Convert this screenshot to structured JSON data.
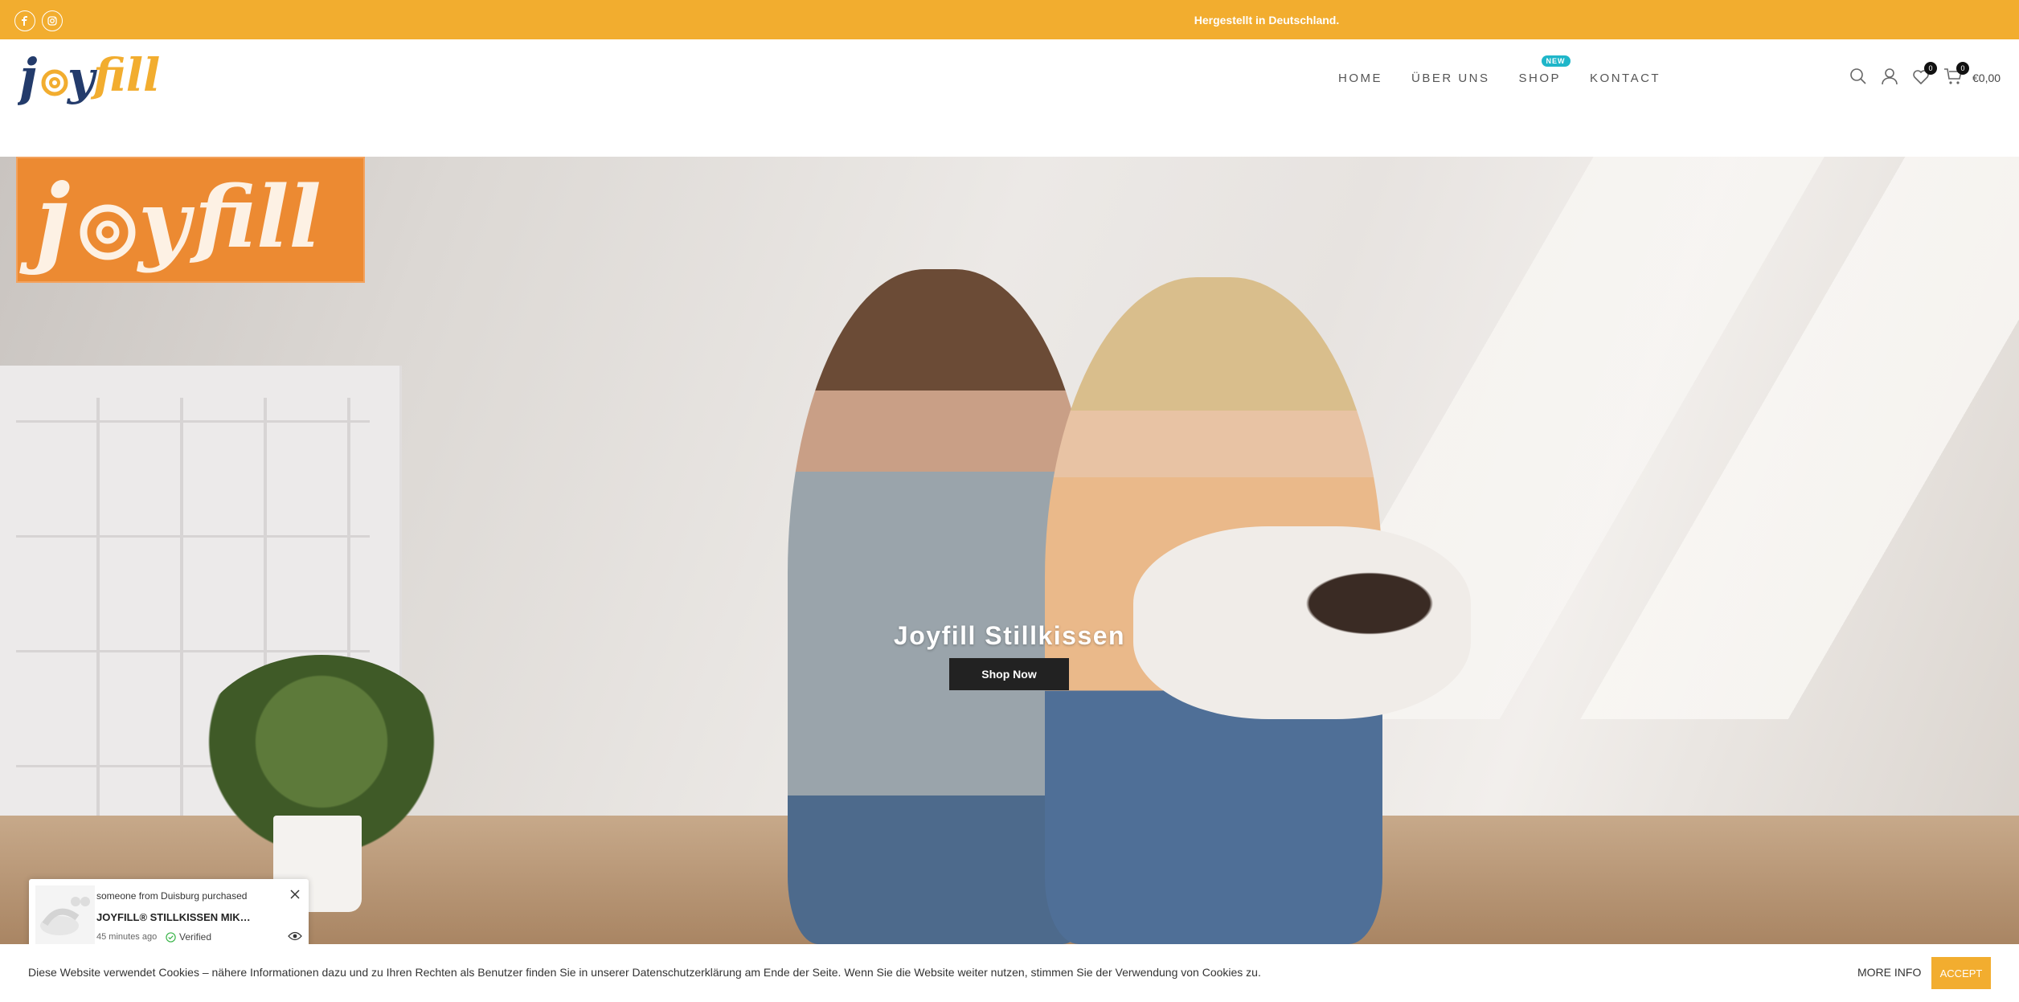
{
  "topbar": {
    "announcement": "Hergestellt in Deutschland.",
    "social": [
      {
        "icon": "facebook-icon"
      },
      {
        "icon": "instagram-icon"
      }
    ],
    "color": "#f2ad2f"
  },
  "header": {
    "logo_text": "joyfill",
    "nav": {
      "home": "HOME",
      "about": "ÜBER UNS",
      "shop": "SHOP",
      "shop_badge": "NEW",
      "contact": "KONTACT"
    },
    "wishlist_count": "0",
    "cart_count": "0",
    "cart_total": "€0,00"
  },
  "hero": {
    "title": "Joyfill Stillkissen",
    "button": "Shop Now"
  },
  "popup": {
    "line1": "someone from Duisburg purchased",
    "product": "JOYFILL® STILLKISSEN MIKROPERLEN...",
    "time": "45 minutes ago",
    "verified": "Verified"
  },
  "cookie": {
    "text": "Diese Website verwendet Cookies – nähere Informationen dazu und zu Ihren Rechten als Benutzer finden Sie in unserer Datenschutzerklärung am Ende der Seite. Wenn Sie die Website weiter nutzen, stimmen Sie der Verwendung von Cookies zu.",
    "more_info": "MORE INFO",
    "accept": "ACCEPT"
  }
}
